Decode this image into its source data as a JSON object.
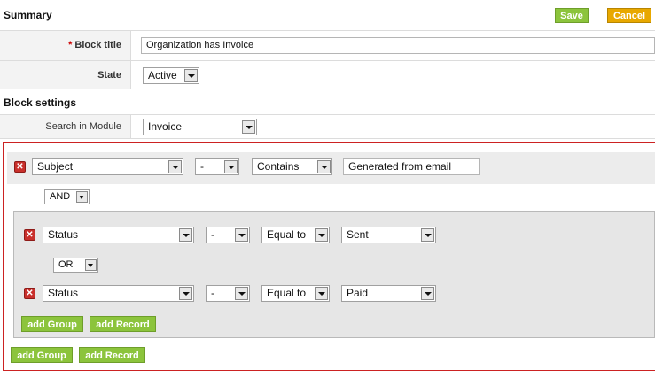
{
  "header": {
    "title": "Summary",
    "save_label": "Save",
    "cancel_label": "Cancel"
  },
  "summary": {
    "block_title_required": "*",
    "block_title_label": "Block title",
    "block_title_value": "Organization has Invoice",
    "state_label": "State",
    "state_value": "Active"
  },
  "block_settings": {
    "title": "Block settings",
    "search_in_module_label": "Search in Module",
    "search_in_module_value": "Invoice"
  },
  "conditions": {
    "row1": {
      "field": "Subject",
      "modifier": "-",
      "operator": "Contains",
      "value": "Generated from email"
    },
    "join1": "AND",
    "group": {
      "row1": {
        "field": "Status",
        "modifier": "-",
        "operator": "Equal to",
        "value": "Sent"
      },
      "join": "OR",
      "row2": {
        "field": "Status",
        "modifier": "-",
        "operator": "Equal to",
        "value": "Paid"
      },
      "add_group_label": "add Group",
      "add_record_label": "add Record"
    },
    "add_group_label": "add Group",
    "add_record_label": "add Record",
    "delete_glyph": "✕"
  }
}
